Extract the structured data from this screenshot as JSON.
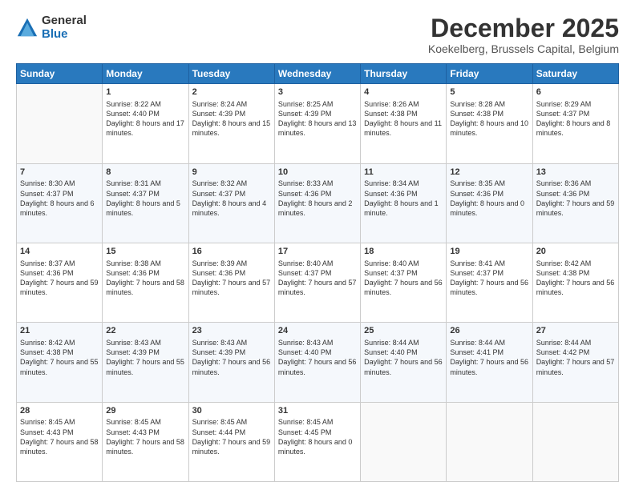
{
  "logo": {
    "general": "General",
    "blue": "Blue"
  },
  "header": {
    "title": "December 2025",
    "subtitle": "Koekelberg, Brussels Capital, Belgium"
  },
  "weekdays": [
    "Sunday",
    "Monday",
    "Tuesday",
    "Wednesday",
    "Thursday",
    "Friday",
    "Saturday"
  ],
  "weeks": [
    [
      {
        "day": "",
        "sunrise": "",
        "sunset": "",
        "daylight": ""
      },
      {
        "day": "1",
        "sunrise": "Sunrise: 8:22 AM",
        "sunset": "Sunset: 4:40 PM",
        "daylight": "Daylight: 8 hours and 17 minutes."
      },
      {
        "day": "2",
        "sunrise": "Sunrise: 8:24 AM",
        "sunset": "Sunset: 4:39 PM",
        "daylight": "Daylight: 8 hours and 15 minutes."
      },
      {
        "day": "3",
        "sunrise": "Sunrise: 8:25 AM",
        "sunset": "Sunset: 4:39 PM",
        "daylight": "Daylight: 8 hours and 13 minutes."
      },
      {
        "day": "4",
        "sunrise": "Sunrise: 8:26 AM",
        "sunset": "Sunset: 4:38 PM",
        "daylight": "Daylight: 8 hours and 11 minutes."
      },
      {
        "day": "5",
        "sunrise": "Sunrise: 8:28 AM",
        "sunset": "Sunset: 4:38 PM",
        "daylight": "Daylight: 8 hours and 10 minutes."
      },
      {
        "day": "6",
        "sunrise": "Sunrise: 8:29 AM",
        "sunset": "Sunset: 4:37 PM",
        "daylight": "Daylight: 8 hours and 8 minutes."
      }
    ],
    [
      {
        "day": "7",
        "sunrise": "Sunrise: 8:30 AM",
        "sunset": "Sunset: 4:37 PM",
        "daylight": "Daylight: 8 hours and 6 minutes."
      },
      {
        "day": "8",
        "sunrise": "Sunrise: 8:31 AM",
        "sunset": "Sunset: 4:37 PM",
        "daylight": "Daylight: 8 hours and 5 minutes."
      },
      {
        "day": "9",
        "sunrise": "Sunrise: 8:32 AM",
        "sunset": "Sunset: 4:37 PM",
        "daylight": "Daylight: 8 hours and 4 minutes."
      },
      {
        "day": "10",
        "sunrise": "Sunrise: 8:33 AM",
        "sunset": "Sunset: 4:36 PM",
        "daylight": "Daylight: 8 hours and 2 minutes."
      },
      {
        "day": "11",
        "sunrise": "Sunrise: 8:34 AM",
        "sunset": "Sunset: 4:36 PM",
        "daylight": "Daylight: 8 hours and 1 minute."
      },
      {
        "day": "12",
        "sunrise": "Sunrise: 8:35 AM",
        "sunset": "Sunset: 4:36 PM",
        "daylight": "Daylight: 8 hours and 0 minutes."
      },
      {
        "day": "13",
        "sunrise": "Sunrise: 8:36 AM",
        "sunset": "Sunset: 4:36 PM",
        "daylight": "Daylight: 7 hours and 59 minutes."
      }
    ],
    [
      {
        "day": "14",
        "sunrise": "Sunrise: 8:37 AM",
        "sunset": "Sunset: 4:36 PM",
        "daylight": "Daylight: 7 hours and 59 minutes."
      },
      {
        "day": "15",
        "sunrise": "Sunrise: 8:38 AM",
        "sunset": "Sunset: 4:36 PM",
        "daylight": "Daylight: 7 hours and 58 minutes."
      },
      {
        "day": "16",
        "sunrise": "Sunrise: 8:39 AM",
        "sunset": "Sunset: 4:36 PM",
        "daylight": "Daylight: 7 hours and 57 minutes."
      },
      {
        "day": "17",
        "sunrise": "Sunrise: 8:40 AM",
        "sunset": "Sunset: 4:37 PM",
        "daylight": "Daylight: 7 hours and 57 minutes."
      },
      {
        "day": "18",
        "sunrise": "Sunrise: 8:40 AM",
        "sunset": "Sunset: 4:37 PM",
        "daylight": "Daylight: 7 hours and 56 minutes."
      },
      {
        "day": "19",
        "sunrise": "Sunrise: 8:41 AM",
        "sunset": "Sunset: 4:37 PM",
        "daylight": "Daylight: 7 hours and 56 minutes."
      },
      {
        "day": "20",
        "sunrise": "Sunrise: 8:42 AM",
        "sunset": "Sunset: 4:38 PM",
        "daylight": "Daylight: 7 hours and 56 minutes."
      }
    ],
    [
      {
        "day": "21",
        "sunrise": "Sunrise: 8:42 AM",
        "sunset": "Sunset: 4:38 PM",
        "daylight": "Daylight: 7 hours and 55 minutes."
      },
      {
        "day": "22",
        "sunrise": "Sunrise: 8:43 AM",
        "sunset": "Sunset: 4:39 PM",
        "daylight": "Daylight: 7 hours and 55 minutes."
      },
      {
        "day": "23",
        "sunrise": "Sunrise: 8:43 AM",
        "sunset": "Sunset: 4:39 PM",
        "daylight": "Daylight: 7 hours and 56 minutes."
      },
      {
        "day": "24",
        "sunrise": "Sunrise: 8:43 AM",
        "sunset": "Sunset: 4:40 PM",
        "daylight": "Daylight: 7 hours and 56 minutes."
      },
      {
        "day": "25",
        "sunrise": "Sunrise: 8:44 AM",
        "sunset": "Sunset: 4:40 PM",
        "daylight": "Daylight: 7 hours and 56 minutes."
      },
      {
        "day": "26",
        "sunrise": "Sunrise: 8:44 AM",
        "sunset": "Sunset: 4:41 PM",
        "daylight": "Daylight: 7 hours and 56 minutes."
      },
      {
        "day": "27",
        "sunrise": "Sunrise: 8:44 AM",
        "sunset": "Sunset: 4:42 PM",
        "daylight": "Daylight: 7 hours and 57 minutes."
      }
    ],
    [
      {
        "day": "28",
        "sunrise": "Sunrise: 8:45 AM",
        "sunset": "Sunset: 4:43 PM",
        "daylight": "Daylight: 7 hours and 58 minutes."
      },
      {
        "day": "29",
        "sunrise": "Sunrise: 8:45 AM",
        "sunset": "Sunset: 4:43 PM",
        "daylight": "Daylight: 7 hours and 58 minutes."
      },
      {
        "day": "30",
        "sunrise": "Sunrise: 8:45 AM",
        "sunset": "Sunset: 4:44 PM",
        "daylight": "Daylight: 7 hours and 59 minutes."
      },
      {
        "day": "31",
        "sunrise": "Sunrise: 8:45 AM",
        "sunset": "Sunset: 4:45 PM",
        "daylight": "Daylight: 8 hours and 0 minutes."
      },
      {
        "day": "",
        "sunrise": "",
        "sunset": "",
        "daylight": ""
      },
      {
        "day": "",
        "sunrise": "",
        "sunset": "",
        "daylight": ""
      },
      {
        "day": "",
        "sunrise": "",
        "sunset": "",
        "daylight": ""
      }
    ]
  ]
}
